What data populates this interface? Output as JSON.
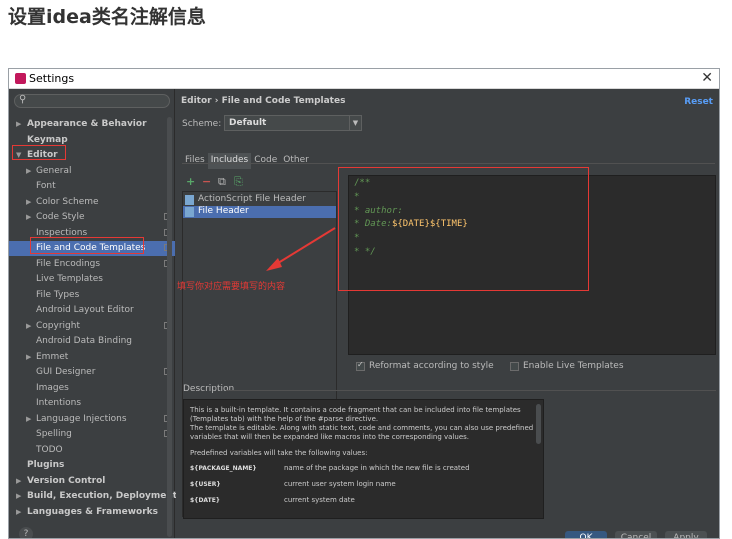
{
  "page": {
    "heading": "设置idea类名注解信息"
  },
  "dialog": {
    "title": "Settings",
    "close": "✕"
  },
  "sidebar": {
    "search_icon": "⚲",
    "items": [
      {
        "label": "Appearance & Behavior",
        "arrow": "▶",
        "bold": true
      },
      {
        "label": "Keymap",
        "arrow": "",
        "bold": true
      },
      {
        "label": "Editor",
        "arrow": "▼",
        "bold": true
      },
      {
        "label": "General",
        "arrow": "▶"
      },
      {
        "label": "Font",
        "arrow": ""
      },
      {
        "label": "Color Scheme",
        "arrow": "▶"
      },
      {
        "label": "Code Style",
        "arrow": "▶",
        "project": true
      },
      {
        "label": "Inspections",
        "arrow": "",
        "project": true
      },
      {
        "label": "File and Code Templates",
        "arrow": "",
        "project": true,
        "selected": true
      },
      {
        "label": "File Encodings",
        "arrow": "",
        "project": true
      },
      {
        "label": "Live Templates",
        "arrow": ""
      },
      {
        "label": "File Types",
        "arrow": ""
      },
      {
        "label": "Android Layout Editor",
        "arrow": ""
      },
      {
        "label": "Copyright",
        "arrow": "▶",
        "project": true
      },
      {
        "label": "Android Data Binding",
        "arrow": ""
      },
      {
        "label": "Emmet",
        "arrow": "▶"
      },
      {
        "label": "GUI Designer",
        "arrow": "",
        "project": true
      },
      {
        "label": "Images",
        "arrow": ""
      },
      {
        "label": "Intentions",
        "arrow": ""
      },
      {
        "label": "Language Injections",
        "arrow": "▶",
        "project": true
      },
      {
        "label": "Spelling",
        "arrow": "",
        "project": true
      },
      {
        "label": "TODO",
        "arrow": ""
      },
      {
        "label": "Plugins",
        "arrow": "",
        "bold": true
      },
      {
        "label": "Version Control",
        "arrow": "▶",
        "bold": true
      },
      {
        "label": "Build, Execution, Deployment",
        "arrow": "▶",
        "bold": true
      },
      {
        "label": "Languages & Frameworks",
        "arrow": "▶",
        "bold": true
      }
    ]
  },
  "main": {
    "breadcrumb": "Editor › File and Code Templates",
    "reset": "Reset",
    "scheme_label": "Scheme:",
    "scheme_value": "Default",
    "scheme_dropdown": "▼",
    "tabs": [
      "Files",
      "Includes",
      "Code",
      "Other"
    ],
    "toolbar": {
      "add": "+",
      "remove": "−",
      "copy": "⧉",
      "reset": "⎘"
    },
    "templates": [
      {
        "label": "ActionScript File Header"
      },
      {
        "label": "File Header",
        "selected": true
      }
    ],
    "editor_lines": [
      {
        "text": "/**",
        "var": ""
      },
      {
        "text": "*",
        "var": ""
      },
      {
        "text": "* author:",
        "var": ""
      },
      {
        "text": "* Date:",
        "var": "${DATE}${TIME}"
      },
      {
        "text": "*",
        "var": ""
      },
      {
        "text": "* */",
        "var": ""
      }
    ],
    "reformat_label": "Reformat according to style",
    "live_templates_label": "Enable Live Templates",
    "description_label": "Description",
    "description": [
      "This is a built-in template. It contains a code fragment that can be included into file templates",
      "(Templates tab) with the help of the #parse directive.",
      "The template is editable. Along with static text, code and comments, you can also use predefined",
      "variables that will then be expanded like macros into the corresponding values."
    ],
    "predefined_intro": "Predefined variables will take the following values:",
    "variables": [
      {
        "name": "${PACKAGE_NAME}",
        "desc": "name of the package in which the new file is created"
      },
      {
        "name": "${USER}",
        "desc": "current user system login name"
      },
      {
        "name": "${DATE}",
        "desc": "current system date"
      }
    ]
  },
  "buttons": {
    "help": "?",
    "ok": "OK",
    "cancel": "Cancel",
    "apply": "Apply"
  },
  "annotation": {
    "text": "填写你对应需要填写的内容"
  },
  "colors": {
    "accent": "#4b6eaf",
    "annotation": "#e53935",
    "link": "#589df6"
  }
}
